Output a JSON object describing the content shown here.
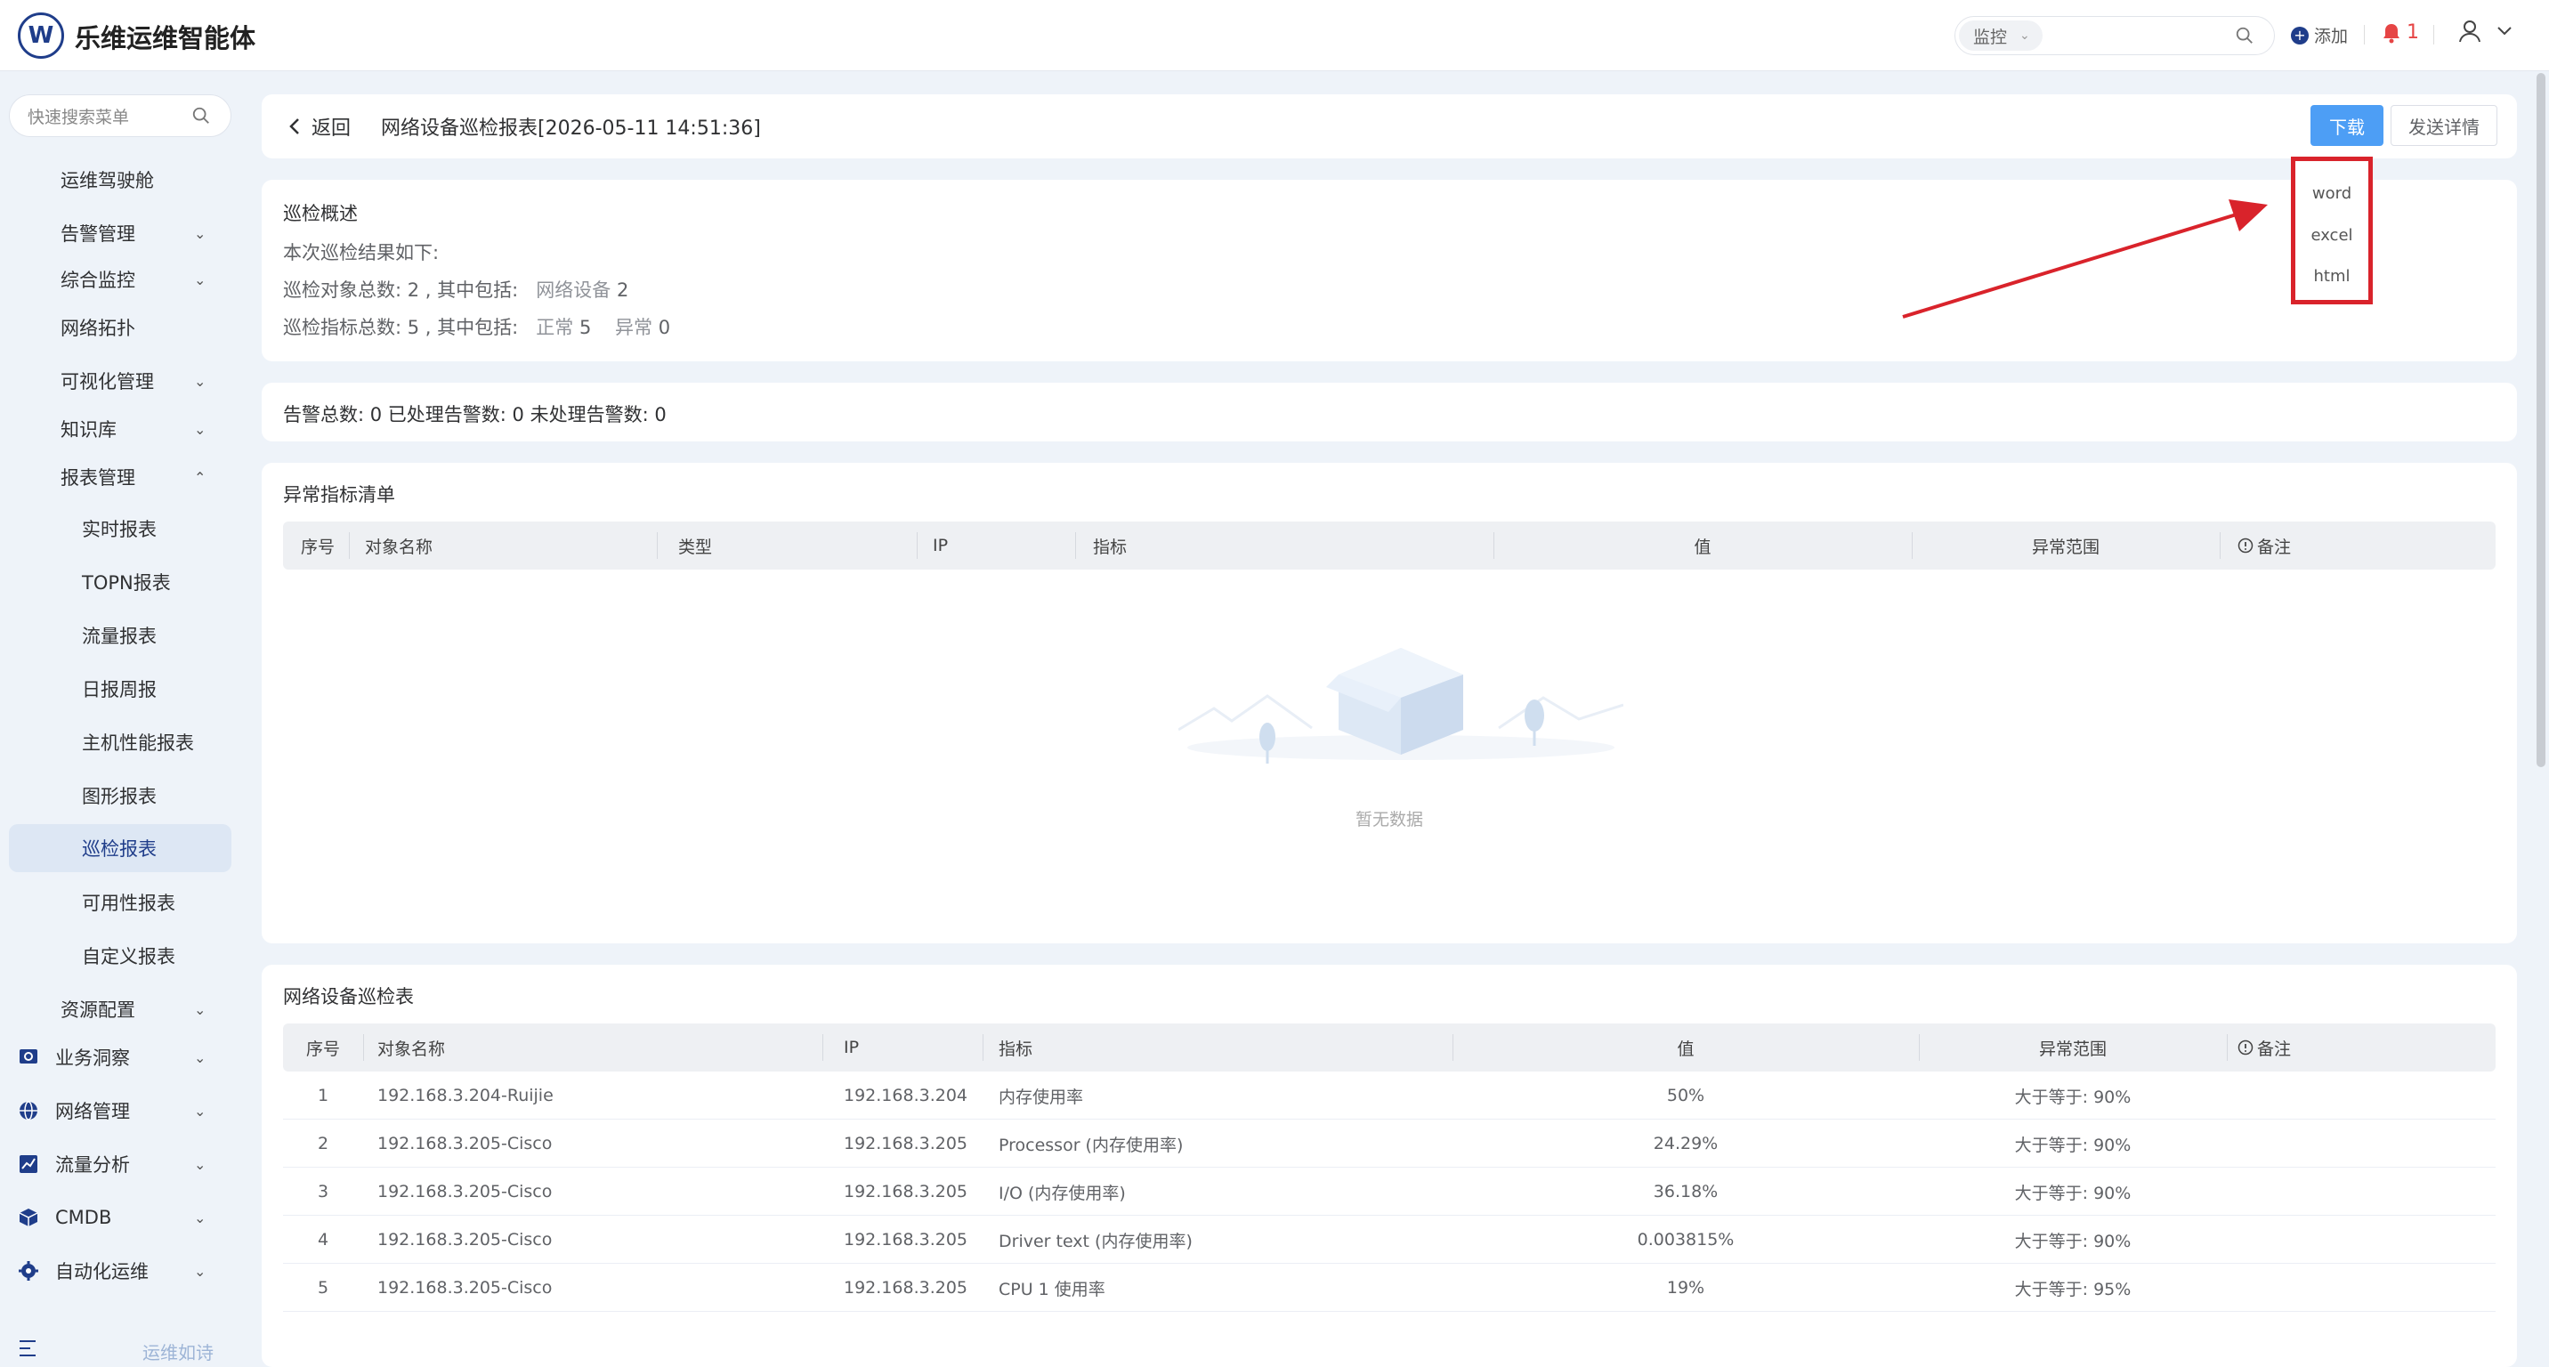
{
  "app": {
    "title": "乐维运维智能体",
    "logo_text": "W"
  },
  "header": {
    "search_scope": "监控",
    "search_placeholder": "",
    "add_label": "添加",
    "notification_count": "1"
  },
  "sidebar": {
    "search_placeholder": "快速搜索菜单",
    "items": [
      {
        "label": "运维驾驶舱",
        "arrow": ""
      },
      {
        "label": "告警管理",
        "arrow": "⌄"
      },
      {
        "label": "综合监控",
        "arrow": "⌄"
      },
      {
        "label": "网络拓扑",
        "arrow": ""
      },
      {
        "label": "可视化管理",
        "arrow": "⌄"
      },
      {
        "label": "知识库",
        "arrow": "⌄"
      },
      {
        "label": "报表管理",
        "arrow": "⌃"
      },
      {
        "label": "实时报表"
      },
      {
        "label": "TOPN报表"
      },
      {
        "label": "流量报表"
      },
      {
        "label": "日报周报"
      },
      {
        "label": "主机性能报表"
      },
      {
        "label": "图形报表"
      },
      {
        "label": "巡检报表"
      },
      {
        "label": "可用性报表"
      },
      {
        "label": "自定义报表"
      },
      {
        "label": "资源配置",
        "arrow": "⌄"
      },
      {
        "label": "业务洞察",
        "arrow": "⌄"
      },
      {
        "label": "网络管理",
        "arrow": "⌄"
      },
      {
        "label": "流量分析",
        "arrow": "⌄"
      },
      {
        "label": "CMDB",
        "arrow": "⌄"
      },
      {
        "label": "自动化运维",
        "arrow": "⌄"
      }
    ],
    "footer_text": "运维如诗"
  },
  "report": {
    "back_label": "返回",
    "title": "网络设备巡检报表[2026-05-11 14:51:36]",
    "download_label": "下载",
    "send_label": "发送详情",
    "download_menu": [
      "word",
      "excel",
      "html"
    ]
  },
  "overview": {
    "title": "巡检概述",
    "line1": "本次巡检结果如下:",
    "line2_prefix": "巡检对象总数: 2 , 其中包括:",
    "line2_cat": "网络设备",
    "line2_val": "2",
    "line3_prefix": "巡检指标总数: 5 , 其中包括:",
    "line3_normal_label": "正常",
    "line3_normal_val": "5",
    "line3_abn_label": "异常",
    "line3_abn_val": "0"
  },
  "alarms": {
    "text": "告警总数: 0 已处理告警数: 0 未处理告警数: 0"
  },
  "abnormal_table": {
    "title": "异常指标清单",
    "headers": [
      "序号",
      "对象名称",
      "类型",
      "IP",
      "指标",
      "值",
      "异常范围",
      "备注"
    ],
    "empty_text": "暂无数据"
  },
  "net_table": {
    "title": "网络设备巡检表",
    "headers": [
      "序号",
      "对象名称",
      "IP",
      "指标",
      "值",
      "异常范围",
      "备注"
    ],
    "rows": [
      {
        "idx": "1",
        "name": "192.168.3.204-Ruijie",
        "ip": "192.168.3.204",
        "metric": "内存使用率",
        "value": "50%",
        "range": "大于等于: 90%"
      },
      {
        "idx": "2",
        "name": "192.168.3.205-Cisco",
        "ip": "192.168.3.205",
        "metric": "Processor (内存使用率)",
        "value": "24.29%",
        "range": "大于等于: 90%"
      },
      {
        "idx": "3",
        "name": "192.168.3.205-Cisco",
        "ip": "192.168.3.205",
        "metric": "I/O (内存使用率)",
        "value": "36.18%",
        "range": "大于等于: 90%"
      },
      {
        "idx": "4",
        "name": "192.168.3.205-Cisco",
        "ip": "192.168.3.205",
        "metric": "Driver text (内存使用率)",
        "value": "0.003815%",
        "range": "大于等于: 90%"
      },
      {
        "idx": "5",
        "name": "192.168.3.205-Cisco",
        "ip": "192.168.3.205",
        "metric": "CPU 1 使用率",
        "value": "19%",
        "range": "大于等于: 95%"
      }
    ]
  },
  "colors": {
    "brand": "#1f3d8a",
    "primary_button": "#4d9ef5",
    "annotation_red": "#d9232b"
  }
}
